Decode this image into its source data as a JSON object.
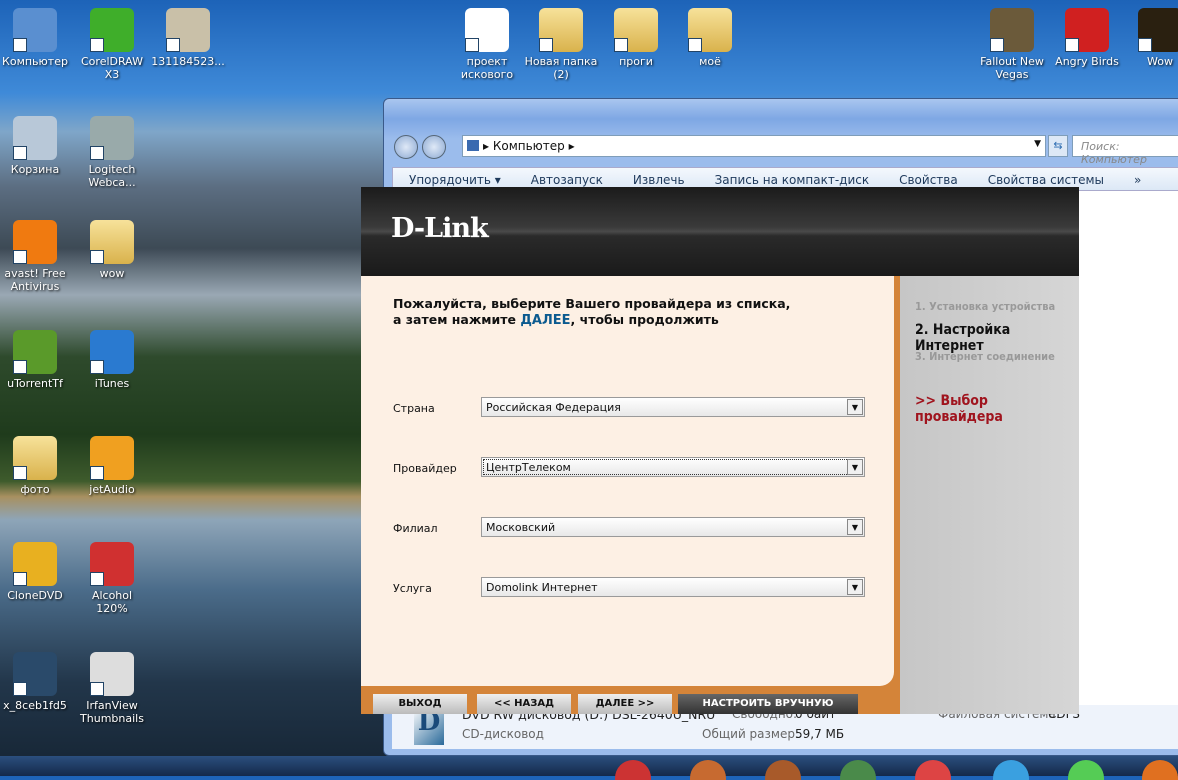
{
  "desktop": {
    "icons": [
      {
        "label": "Компьютер",
        "color": "#5a8fd0"
      },
      {
        "label": "CorelDRAW X3",
        "color": "#3fae2a"
      },
      {
        "label": "131184523...",
        "color": "#c9c0a8"
      },
      {
        "label": "проект искового",
        "color": "#ffffff"
      },
      {
        "label": "Новая папка (2)",
        "color": "folder"
      },
      {
        "label": "проги",
        "color": "folder"
      },
      {
        "label": "моё",
        "color": "folder"
      },
      {
        "label": "Fallout New Vegas",
        "color": "#6b5a3a"
      },
      {
        "label": "Angry Birds",
        "color": "#d02020"
      },
      {
        "label": "Wow",
        "color": "#2a2010"
      },
      {
        "label": "Корзина",
        "color": "#b8c8d8"
      },
      {
        "label": "Logitech Webca...",
        "color": "#9aa"
      },
      {
        "label": "avast! Free Antivirus",
        "color": "#f07a10"
      },
      {
        "label": "wow",
        "color": "folder"
      },
      {
        "label": "uTorrentTf",
        "color": "#5a9a2a"
      },
      {
        "label": "iTunes",
        "color": "#2a7ad0"
      },
      {
        "label": "фото",
        "color": "folder"
      },
      {
        "label": "jetAudio",
        "color": "#f0a020"
      },
      {
        "label": "CloneDVD",
        "color": "#e8b020"
      },
      {
        "label": "Alcohol 120%",
        "color": "#d03030"
      },
      {
        "label": "x_8ceb1fd5",
        "color": "#2a4a6a"
      },
      {
        "label": "IrfanView Thumbnails",
        "color": "#ddd"
      }
    ]
  },
  "explorer": {
    "address": "Компьютер",
    "search_placeholder": "Поиск: Компьютер",
    "commands": [
      "Упорядочить ▾",
      "Автозапуск",
      "Извлечь",
      "Запись на компакт-диск",
      "Свойства",
      "Свойства системы",
      "»"
    ],
    "details": {
      "name": "DVD RW дисковод (D:) DSL-2640U_NRU",
      "type": "CD-дисковод",
      "free_label": "Свободно:",
      "free": "0 байт",
      "total_label": "Общий размер:",
      "total": "59,7 МБ",
      "fs_label": "Файловая система:",
      "fs": "CDFS"
    }
  },
  "dlink": {
    "logo": "D-Link",
    "intro_line1": "Пожалуйста, выберите Вашего провайдера из списка,",
    "intro_pre": "а затем нажмите ",
    "intro_highlight": "ДАЛЕЕ",
    "intro_post": ", чтобы продолжить",
    "fields": [
      {
        "label": "Страна",
        "value": "Российская Федерация"
      },
      {
        "label": "Провайдер",
        "value": "ЦентрТелеком"
      },
      {
        "label": "Филиал",
        "value": "Московский"
      },
      {
        "label": "Услуга",
        "value": "Domolink Интернет"
      }
    ],
    "steps": [
      "1. Установка устройства",
      "2. Настройка Интернет",
      "3. Интернет соединение"
    ],
    "current_substep": ">> Выбор провайдера",
    "buttons": {
      "exit": "ВЫХОД",
      "back": "<< НАЗАД",
      "next": "ДАЛЕЕ >>",
      "manual": "НАСТРОИТЬ ВРУЧНУЮ"
    }
  }
}
